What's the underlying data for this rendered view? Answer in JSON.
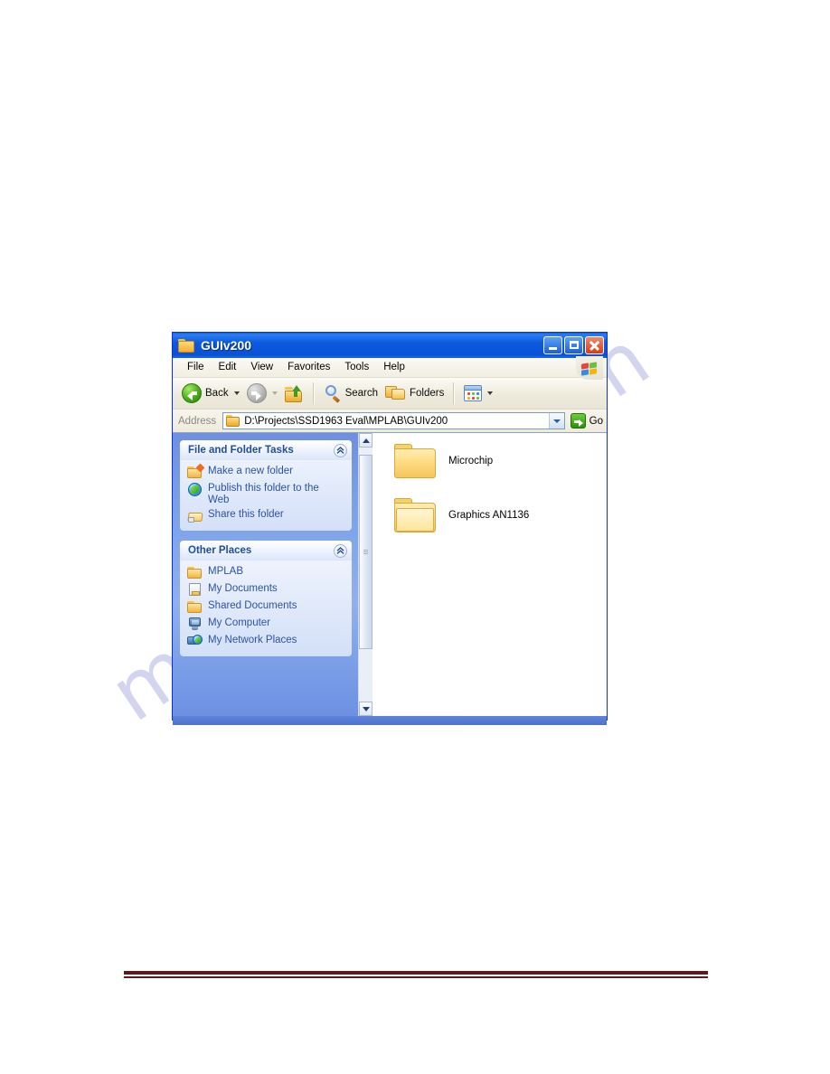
{
  "page": {
    "watermark_text": "manualslib.com",
    "footer_rule_color": "#5a1a1e"
  },
  "window": {
    "title": "GUIv200",
    "title_icon": "folder-icon",
    "controls": {
      "minimize": "minimize-button",
      "maximize": "maximize-button",
      "close": "close-button"
    }
  },
  "menu": {
    "items": [
      {
        "label": "File"
      },
      {
        "label": "Edit"
      },
      {
        "label": "View"
      },
      {
        "label": "Favorites"
      },
      {
        "label": "Tools"
      },
      {
        "label": "Help"
      }
    ],
    "brand_icon": "windows-flag-icon"
  },
  "toolbar": {
    "back_label": "Back",
    "back_icon": "back-arrow-icon",
    "forward_icon": "forward-arrow-icon",
    "up_icon": "up-one-level-icon",
    "search_label": "Search",
    "search_icon": "magnifier-icon",
    "folders_label": "Folders",
    "folders_icon": "folders-icon",
    "views_icon": "views-icon"
  },
  "address": {
    "label": "Address",
    "value": "D:\\Projects\\SSD1963 Eval\\MPLAB\\GUIv200",
    "placeholder": "Address",
    "folder_icon": "folder-icon",
    "dropdown_icon": "chevron-down-icon",
    "go_label": "Go",
    "go_icon": "go-arrow-icon"
  },
  "sidebar": {
    "panels": [
      {
        "title": "File and Folder Tasks",
        "collapse_icon": "chevron-up-icon",
        "items": [
          {
            "label": "Make a new folder",
            "icon": "new-folder-icon"
          },
          {
            "label": "Publish this folder to the Web",
            "icon": "publish-web-icon"
          },
          {
            "label": "Share this folder",
            "icon": "share-folder-icon"
          }
        ]
      },
      {
        "title": "Other Places",
        "collapse_icon": "chevron-up-icon",
        "items": [
          {
            "label": "MPLAB",
            "icon": "folder-icon"
          },
          {
            "label": "My Documents",
            "icon": "my-documents-icon"
          },
          {
            "label": "Shared Documents",
            "icon": "shared-documents-icon"
          },
          {
            "label": "My Computer",
            "icon": "my-computer-icon"
          },
          {
            "label": "My Network Places",
            "icon": "my-network-places-icon"
          }
        ]
      }
    ]
  },
  "content": {
    "files": [
      {
        "name": "Microchip",
        "icon": "folder-icon",
        "state": "closed"
      },
      {
        "name": "Graphics AN1136",
        "icon": "folder-open-icon",
        "state": "open"
      }
    ],
    "scrollbar": {
      "up_icon": "scroll-up-icon",
      "down_icon": "scroll-down-icon",
      "thumb": "scroll-thumb"
    }
  }
}
